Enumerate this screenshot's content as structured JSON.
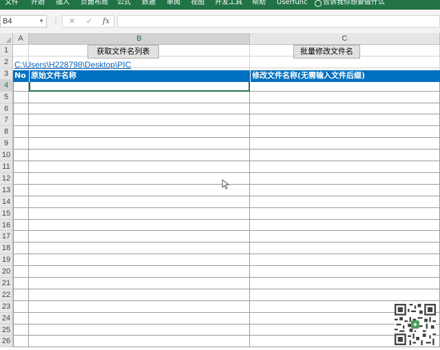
{
  "ribbon": {
    "tabs": [
      "文件",
      "开始",
      "插入",
      "页面布局",
      "公式",
      "数据",
      "审阅",
      "视图",
      "开发工具",
      "帮助",
      "Userfunc"
    ],
    "tell_me": "告诉我你想要做什么"
  },
  "formula_bar": {
    "name_box": "B4",
    "cancel_icon": "✕",
    "enter_icon": "✓",
    "fx_label": "fx",
    "value": ""
  },
  "columns": [
    "A",
    "B",
    "C"
  ],
  "rows": [
    "1",
    "2",
    "3",
    "4",
    "5",
    "6",
    "7",
    "8",
    "9",
    "10",
    "11",
    "12",
    "13",
    "14",
    "15",
    "16",
    "17",
    "18",
    "19",
    "20",
    "21",
    "22",
    "23",
    "24",
    "25",
    "26"
  ],
  "sheet": {
    "button_get_list": "获取文件名列表",
    "button_rename": "批量修改文件名",
    "folder_path": "C:\\Users\\H228798\\Desktop\\PIC",
    "table_headers": [
      "No",
      "原始文件名称",
      "修改文件名称(无需输入文件后缀)"
    ]
  },
  "colors": {
    "ribbon": "#217346",
    "table_header": "#0070c0",
    "link": "#0563c1"
  }
}
